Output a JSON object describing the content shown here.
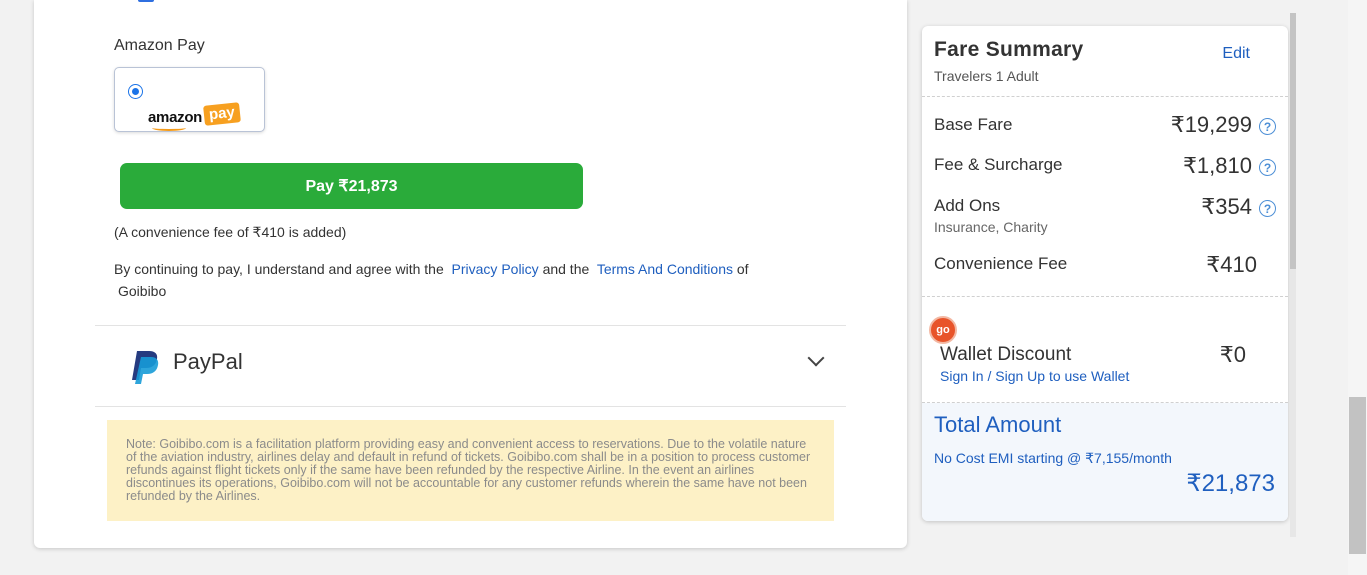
{
  "payment": {
    "amazon_label": "Amazon Pay",
    "amazon_logo_word": "amazon",
    "amazon_logo_badge": "pay",
    "pay_button_label": "Pay ₹21,873",
    "fee_note": "(A convenience fee of ₹410 is added)",
    "agree_prefix": "By continuing to pay, I understand and agree with the",
    "privacy_link": "Privacy Policy",
    "agree_and": "and the",
    "terms_link": "Terms And Conditions",
    "agree_of": "of",
    "company": "Goibibo",
    "paypal_label": "PayPal",
    "note": "Note: Goibibo.com is a facilitation platform providing easy and convenient access to reservations. Due to the volatile nature of the aviation industry, airlines delay and default in refund of tickets. Goibibo.com shall be in a position to process customer refunds against flight tickets only if the same have been refunded by the respective Airline. In the event an airlines discontinues its operations, Goibibo.com will not be accountable for any customer refunds wherein the same have not been refunded by the Airlines."
  },
  "fare_summary": {
    "title": "Fare Summary",
    "edit_label": "Edit",
    "travelers": "Travelers 1 Adult",
    "rows": [
      {
        "label": "Base Fare",
        "value": "₹19,299",
        "help": true
      },
      {
        "label": "Fee & Surcharge",
        "value": "₹1,810",
        "help": true
      },
      {
        "label": "Add Ons",
        "sub": "Insurance, Charity",
        "value": "₹354",
        "help": true
      },
      {
        "label": "Convenience Fee",
        "value": "₹410",
        "help": false
      }
    ],
    "help_glyph": "?",
    "wallet": {
      "badge": "go",
      "label": "Wallet Discount",
      "value": "₹0",
      "link": "Sign In / Sign Up to use Wallet"
    },
    "total_label": "Total Amount",
    "emi_text": "No Cost EMI starting @ ₹7,155/month",
    "total_value": "₹21,873"
  },
  "colors": {
    "pay_green": "#2aab3a",
    "link_blue": "#1f5fbf",
    "note_bg": "#fdf1c6",
    "paypal_dark": "#253b80",
    "paypal_light": "#179bd7"
  }
}
